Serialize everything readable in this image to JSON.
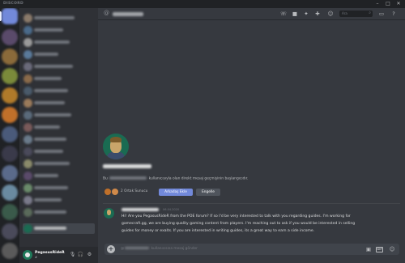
{
  "app": {
    "title": "DISCORD"
  },
  "window_controls": [
    "–",
    "□",
    "✕"
  ],
  "user_panel": {
    "username": "PegasusRideR",
    "tag": "#"
  },
  "header": {
    "search_placeholder": "Ara"
  },
  "chat": {
    "intro_prefix": "Bu",
    "intro_suffix": "kullanıcısıyla olan direkt mesaj geçmişinin başlangıcıdır.",
    "mutual_servers": "2 Ortak Sunucu",
    "add_friend_label": "Arkadaş Ekle",
    "block_label": "Engelle",
    "message": {
      "timestamp": "06.04.2020",
      "lines": [
        "Hi! Are you PegasusRideR from the POE forum? If so I'd be very interested to talk with you regarding guides. I'm working for",
        "gamecraft.gg, we are buying quality gaming content from players. I'm reaching out to ask if you would be interested in selling",
        "guides for money or exalts. If you are interested in writing guides, its a great way to earn a side income."
      ]
    }
  },
  "composer": {
    "placeholder_suffix": "kullanıcısına mesaj gönder"
  },
  "colors": {
    "accent": "#7289da",
    "background": "#36393f",
    "sidebar": "#2f3136",
    "rail": "#202225"
  }
}
